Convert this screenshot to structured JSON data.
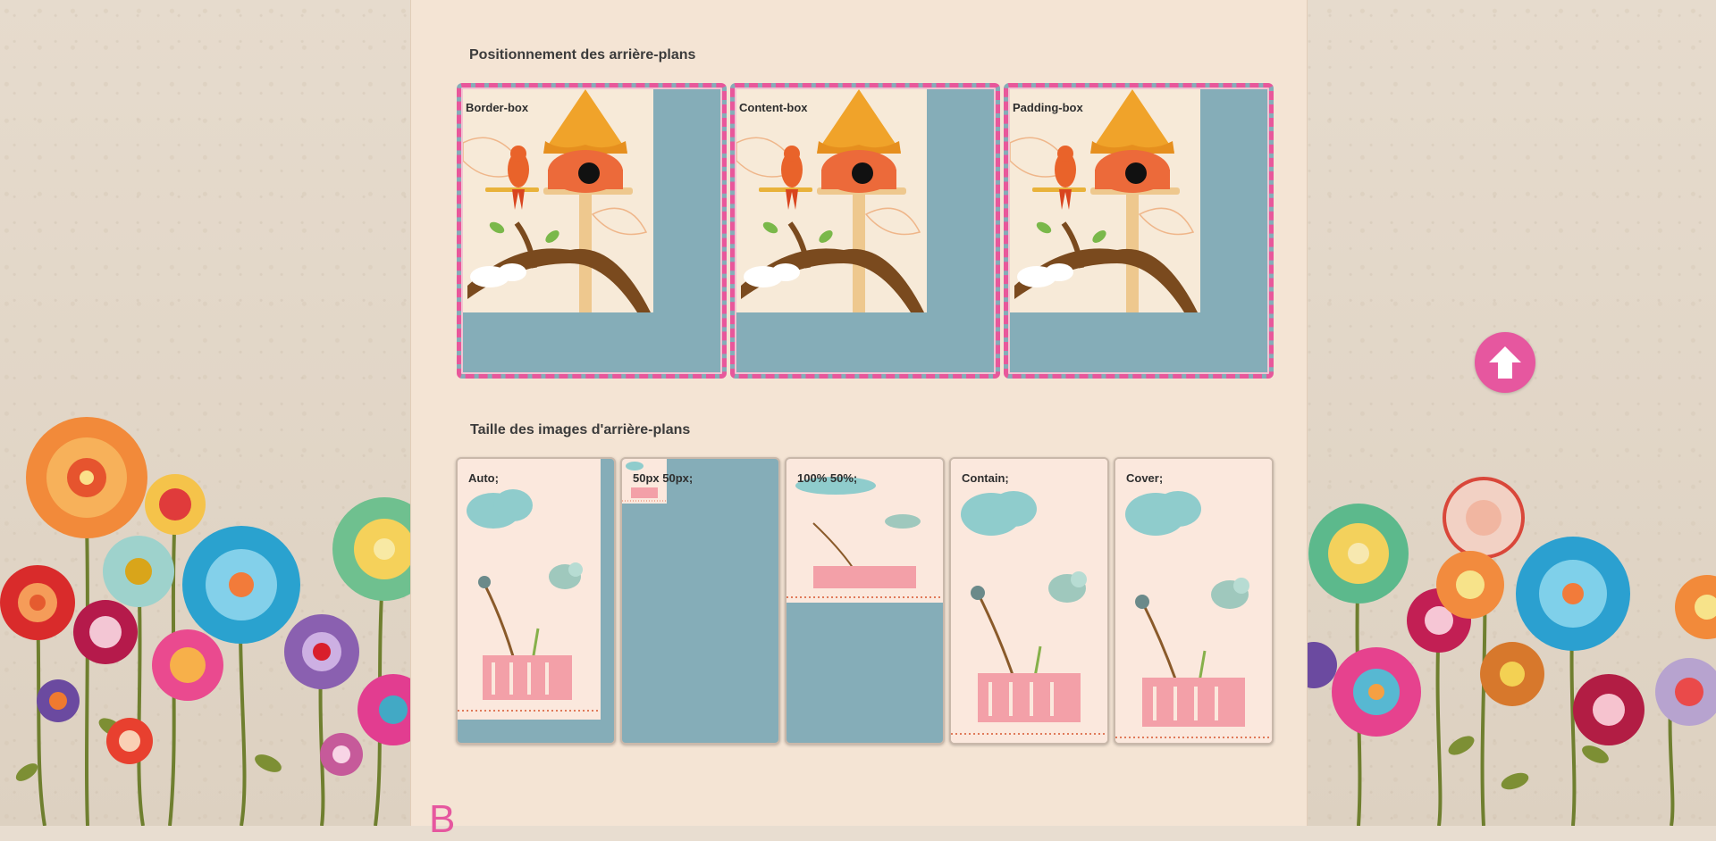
{
  "sections": {
    "positioning": {
      "title": "Positionnement des arrière-plans",
      "boxes": [
        {
          "label": "Border-box"
        },
        {
          "label": "Content-box"
        },
        {
          "label": "Padding-box"
        }
      ]
    },
    "sizing": {
      "title": "Taille des images d'arrière-plans",
      "boxes": [
        {
          "label": "Auto;"
        },
        {
          "label": "50px 50px;"
        },
        {
          "label": "100% 50%;"
        },
        {
          "label": "Contain;"
        },
        {
          "label": "Cover;"
        }
      ]
    }
  },
  "next_section_initial": "B",
  "scroll_top_icon": "arrow-up-icon",
  "colors": {
    "page_bg": "#e8ddd0",
    "content_bg": "#f4e4d4",
    "box_bg": "#85adb8",
    "accent_pink": "#e8579b"
  }
}
